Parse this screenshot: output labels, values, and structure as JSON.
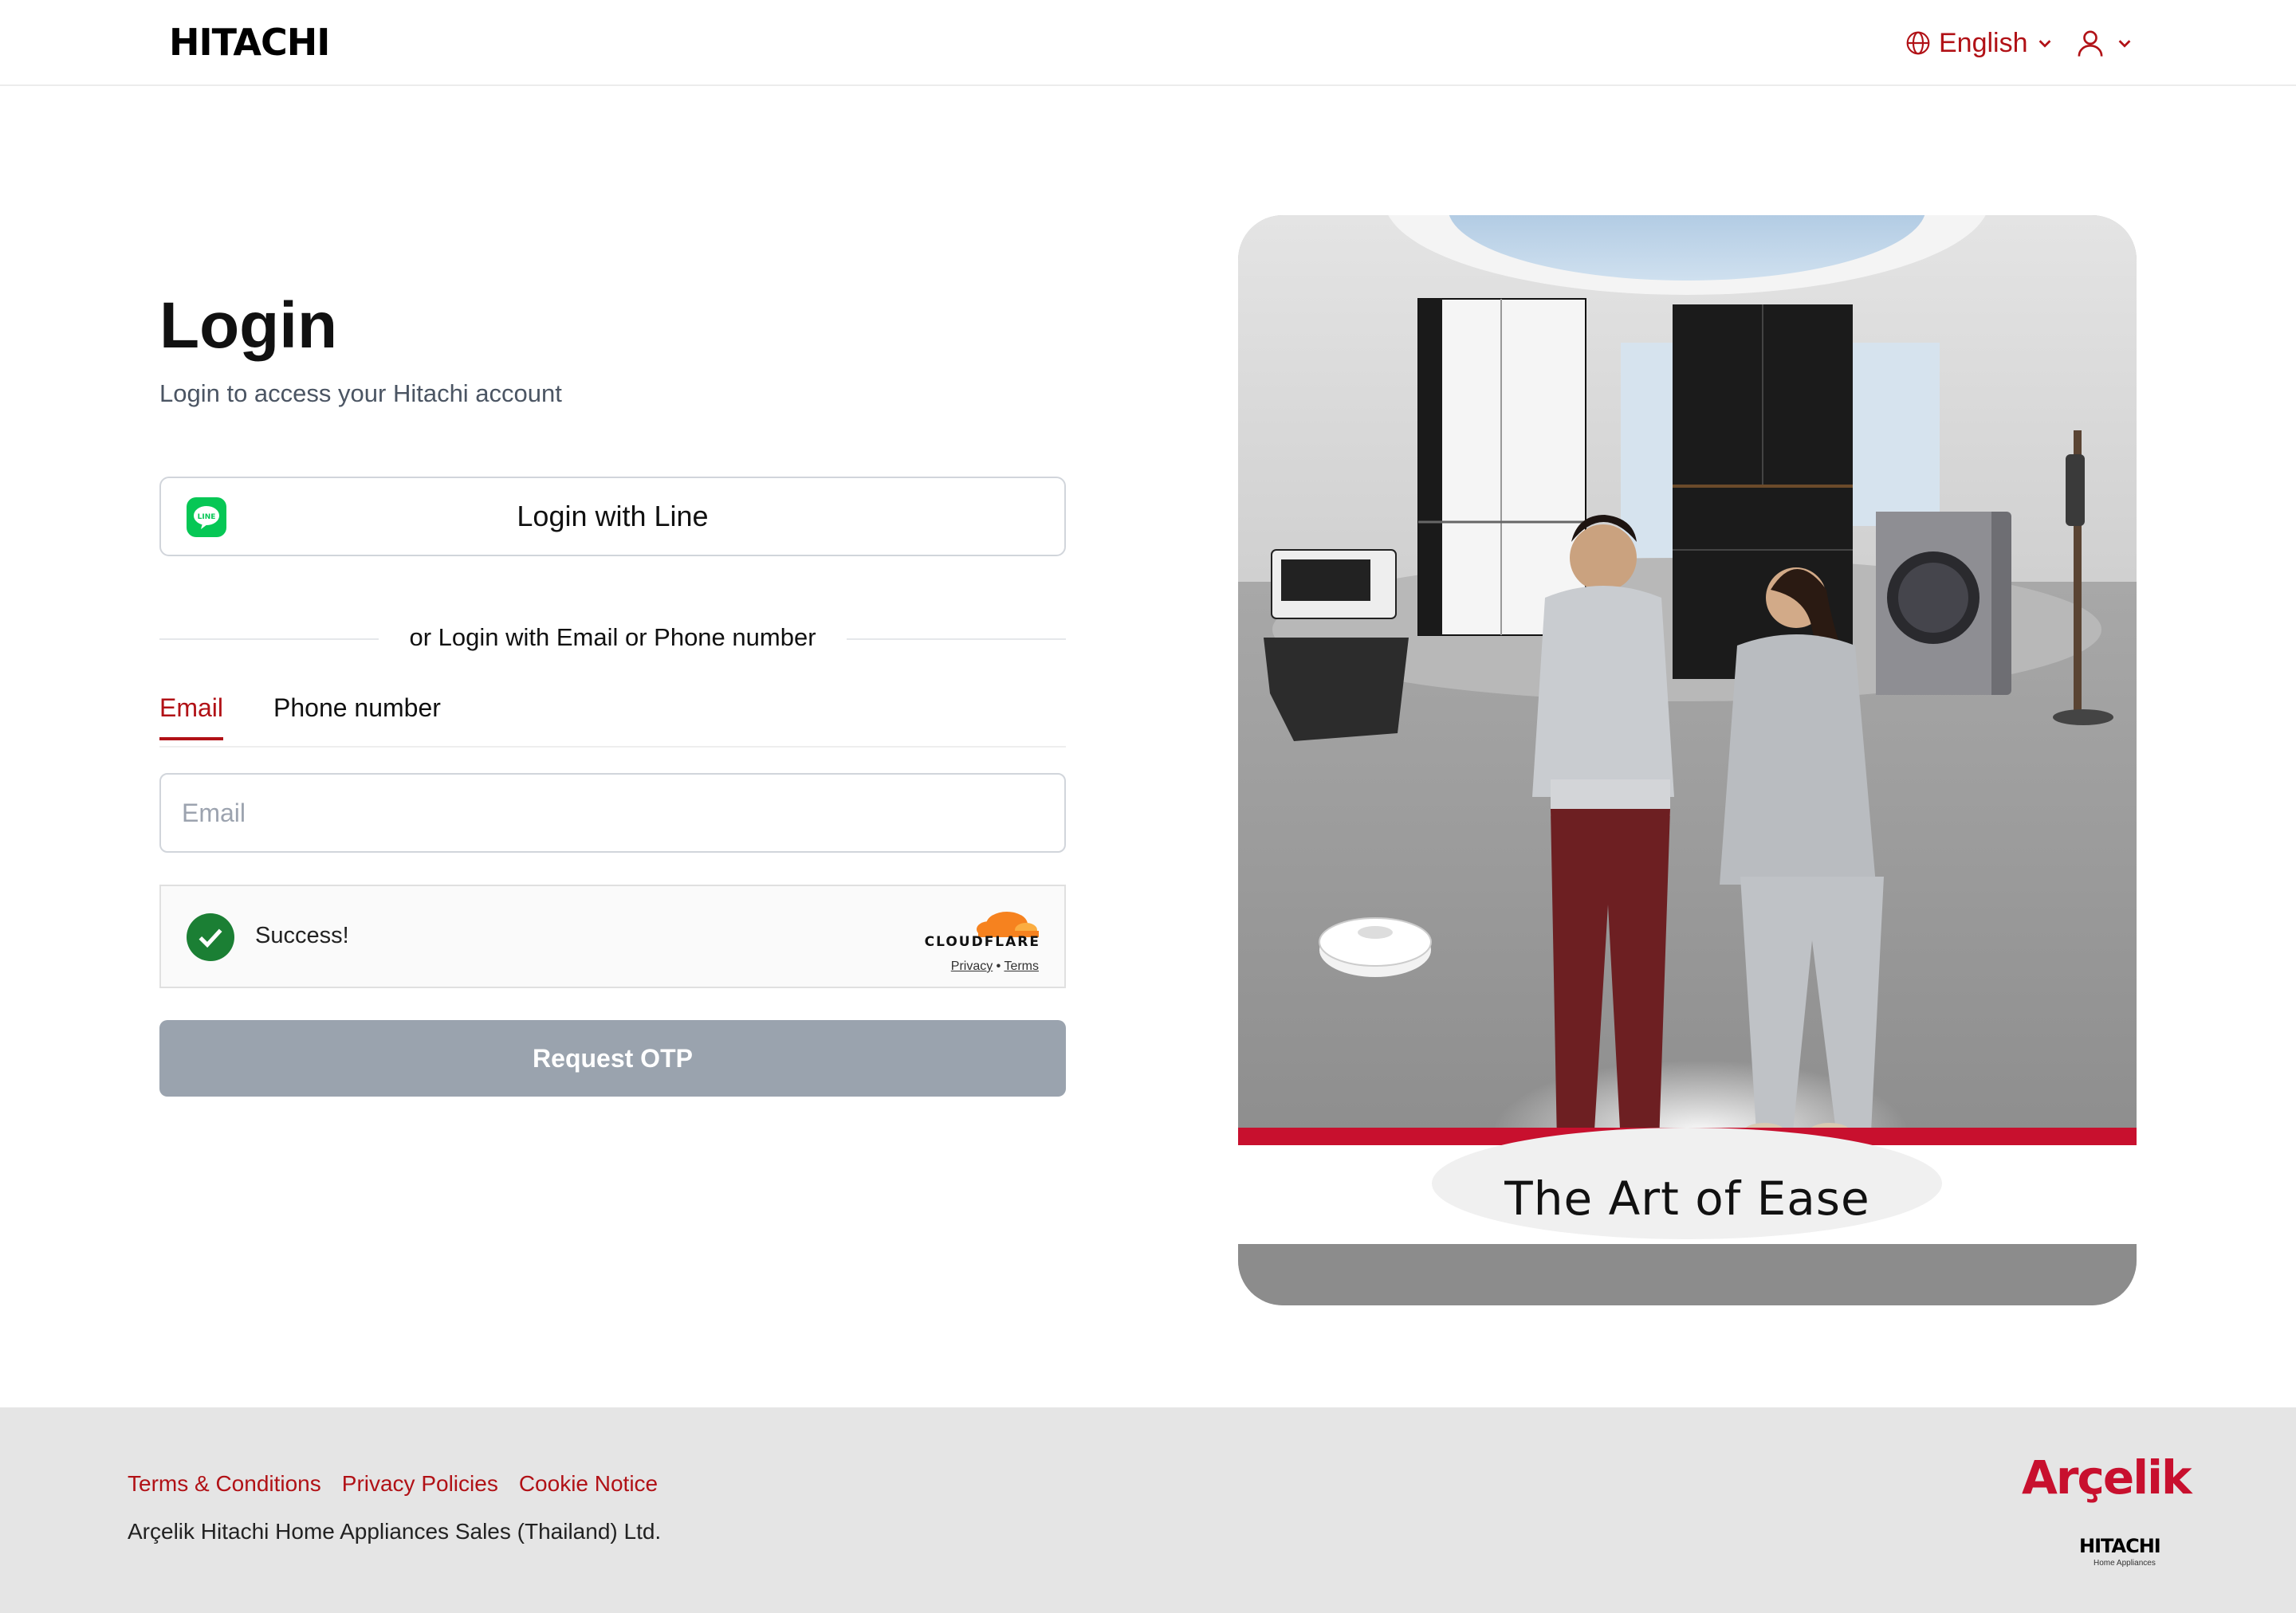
{
  "header": {
    "logo": "HITACHI",
    "language": "English"
  },
  "login": {
    "title": "Login",
    "subtitle": "Login to access your Hitachi account",
    "line_button": "Login with Line",
    "line_icon_text": "LINE",
    "divider_text": "or Login with Email or Phone number",
    "tabs": [
      {
        "label": "Email",
        "active": true
      },
      {
        "label": "Phone number",
        "active": false
      }
    ],
    "email_placeholder": "Email",
    "email_value": "",
    "captcha": {
      "status": "Success!",
      "provider": "CLOUDFLARE",
      "privacy": "Privacy",
      "separator": "•",
      "terms": "Terms"
    },
    "otp_button": "Request OTP"
  },
  "hero": {
    "caption": "The Art of Ease"
  },
  "footer": {
    "links": [
      "Terms & Conditions",
      "Privacy Policies",
      "Cookie Notice"
    ],
    "company": "Arçelik Hitachi Home Appliances Sales (Thailand) Ltd.",
    "brand_primary": "Arçelik",
    "brand_secondary": "HITACHI",
    "brand_secondary_sub": "Home Appliances"
  },
  "colors": {
    "accent": "#b11116",
    "button_disabled": "#9aa3ae",
    "line_green": "#06c755",
    "success_green": "#1b7f34",
    "footer_bg": "#e5e5e5"
  },
  "icons": [
    "globe-icon",
    "chevron-down-icon",
    "user-icon",
    "line-icon",
    "check-icon",
    "cloudflare-icon"
  ]
}
